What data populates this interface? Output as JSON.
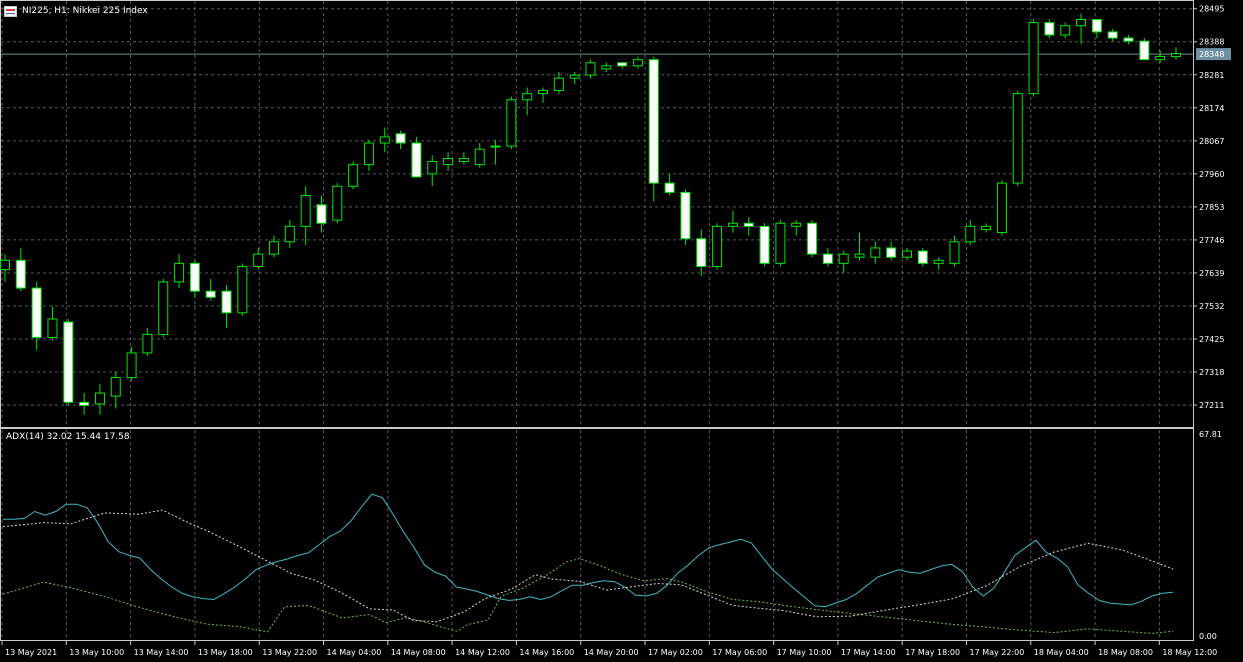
{
  "window": {
    "symbol_title": "NI225, H1:  Nikkei 225 Index",
    "indicator_label": "ADX(14) 32.02 15.44 17.58"
  },
  "colors": {
    "background": "#000000",
    "grid": "#5a5a5a",
    "bull_candle": "#000000",
    "bear_candle": "#ffffff",
    "candle_outline": "#00e600",
    "adx_line": "#3fb8c8",
    "plus_di": "#d8d8d8",
    "minus_di": "#6dbf4b",
    "current_price_line": "#6f8fa3",
    "axis_text": "#ffffff"
  },
  "price_axis": {
    "labels": [
      "28495",
      "28388",
      "28281",
      "28174",
      "28067",
      "27960",
      "27853",
      "27746",
      "27639",
      "27532",
      "27425",
      "27318",
      "27211"
    ],
    "current_price": "28348"
  },
  "indicator_axis": {
    "labels": [
      "67.81",
      "0.00"
    ]
  },
  "time_axis": {
    "labels": [
      "13 May 2021",
      "13 May 10:00",
      "13 May 14:00",
      "13 May 18:00",
      "13 May 22:00",
      "14 May 04:00",
      "14 May 08:00",
      "14 May 12:00",
      "14 May 16:00",
      "14 May 20:00",
      "17 May 02:00",
      "17 May 06:00",
      "17 May 10:00",
      "17 May 14:00",
      "17 May 18:00",
      "17 May 22:00",
      "18 May 04:00",
      "18 May 08:00",
      "18 May 12:00"
    ]
  },
  "chart_data": {
    "type": "candlestick",
    "price_range": [
      27140,
      28520
    ],
    "candles": [
      {
        "o": 27650,
        "h": 27700,
        "l": 27610,
        "c": 27680
      },
      {
        "o": 27680,
        "h": 27720,
        "l": 27580,
        "c": 27590
      },
      {
        "o": 27590,
        "h": 27610,
        "l": 27390,
        "c": 27430
      },
      {
        "o": 27430,
        "h": 27530,
        "l": 27420,
        "c": 27490
      },
      {
        "o": 27480,
        "h": 27490,
        "l": 27210,
        "c": 27220
      },
      {
        "o": 27220,
        "h": 27250,
        "l": 27180,
        "c": 27210
      },
      {
        "o": 27215,
        "h": 27280,
        "l": 27180,
        "c": 27250
      },
      {
        "o": 27240,
        "h": 27320,
        "l": 27200,
        "c": 27300
      },
      {
        "o": 27300,
        "h": 27400,
        "l": 27290,
        "c": 27380
      },
      {
        "o": 27380,
        "h": 27460,
        "l": 27370,
        "c": 27440
      },
      {
        "o": 27440,
        "h": 27620,
        "l": 27430,
        "c": 27610
      },
      {
        "o": 27610,
        "h": 27700,
        "l": 27590,
        "c": 27670
      },
      {
        "o": 27670,
        "h": 27680,
        "l": 27560,
        "c": 27580
      },
      {
        "o": 27580,
        "h": 27620,
        "l": 27550,
        "c": 27560
      },
      {
        "o": 27580,
        "h": 27600,
        "l": 27460,
        "c": 27510
      },
      {
        "o": 27510,
        "h": 27670,
        "l": 27500,
        "c": 27660
      },
      {
        "o": 27660,
        "h": 27720,
        "l": 27650,
        "c": 27700
      },
      {
        "o": 27700,
        "h": 27760,
        "l": 27690,
        "c": 27740
      },
      {
        "o": 27740,
        "h": 27810,
        "l": 27720,
        "c": 27790
      },
      {
        "o": 27790,
        "h": 27920,
        "l": 27730,
        "c": 27890
      },
      {
        "o": 27860,
        "h": 27890,
        "l": 27770,
        "c": 27800
      },
      {
        "o": 27810,
        "h": 27930,
        "l": 27800,
        "c": 27920
      },
      {
        "o": 27920,
        "h": 28000,
        "l": 27910,
        "c": 27990
      },
      {
        "o": 27990,
        "h": 28070,
        "l": 27970,
        "c": 28060
      },
      {
        "o": 28060,
        "h": 28110,
        "l": 28030,
        "c": 28080
      },
      {
        "o": 28090,
        "h": 28100,
        "l": 28040,
        "c": 28060
      },
      {
        "o": 28060,
        "h": 28080,
        "l": 27950,
        "c": 27950
      },
      {
        "o": 27960,
        "h": 28020,
        "l": 27920,
        "c": 28000
      },
      {
        "o": 27990,
        "h": 28030,
        "l": 27970,
        "c": 28010
      },
      {
        "o": 28000,
        "h": 28030,
        "l": 27990,
        "c": 28010
      },
      {
        "o": 27990,
        "h": 28060,
        "l": 27980,
        "c": 28040
      },
      {
        "o": 28050,
        "h": 28070,
        "l": 27990,
        "c": 28050
      },
      {
        "o": 28050,
        "h": 28210,
        "l": 28040,
        "c": 28200
      },
      {
        "o": 28200,
        "h": 28240,
        "l": 28150,
        "c": 28220
      },
      {
        "o": 28220,
        "h": 28240,
        "l": 28190,
        "c": 28230
      },
      {
        "o": 28230,
        "h": 28290,
        "l": 28220,
        "c": 28270
      },
      {
        "o": 28270,
        "h": 28290,
        "l": 28250,
        "c": 28280
      },
      {
        "o": 28280,
        "h": 28330,
        "l": 28270,
        "c": 28320
      },
      {
        "o": 28300,
        "h": 28320,
        "l": 28290,
        "c": 28310
      },
      {
        "o": 28320,
        "h": 28320,
        "l": 28300,
        "c": 28310
      },
      {
        "o": 28310,
        "h": 28340,
        "l": 28300,
        "c": 28330
      },
      {
        "o": 28330,
        "h": 28340,
        "l": 27870,
        "c": 27930
      },
      {
        "o": 27930,
        "h": 27960,
        "l": 27890,
        "c": 27900
      },
      {
        "o": 27900,
        "h": 27910,
        "l": 27730,
        "c": 27750
      },
      {
        "o": 27750,
        "h": 27780,
        "l": 27630,
        "c": 27660
      },
      {
        "o": 27660,
        "h": 27800,
        "l": 27650,
        "c": 27790
      },
      {
        "o": 27790,
        "h": 27840,
        "l": 27770,
        "c": 27800
      },
      {
        "o": 27800,
        "h": 27820,
        "l": 27760,
        "c": 27790
      },
      {
        "o": 27790,
        "h": 27800,
        "l": 27660,
        "c": 27670
      },
      {
        "o": 27670,
        "h": 27810,
        "l": 27660,
        "c": 27800
      },
      {
        "o": 27790,
        "h": 27810,
        "l": 27760,
        "c": 27800
      },
      {
        "o": 27800,
        "h": 27810,
        "l": 27690,
        "c": 27700
      },
      {
        "o": 27700,
        "h": 27720,
        "l": 27660,
        "c": 27670
      },
      {
        "o": 27670,
        "h": 27710,
        "l": 27640,
        "c": 27700
      },
      {
        "o": 27690,
        "h": 27770,
        "l": 27680,
        "c": 27700
      },
      {
        "o": 27690,
        "h": 27740,
        "l": 27670,
        "c": 27720
      },
      {
        "o": 27720,
        "h": 27740,
        "l": 27680,
        "c": 27690
      },
      {
        "o": 27690,
        "h": 27720,
        "l": 27680,
        "c": 27710
      },
      {
        "o": 27710,
        "h": 27720,
        "l": 27660,
        "c": 27670
      },
      {
        "o": 27670,
        "h": 27690,
        "l": 27650,
        "c": 27680
      },
      {
        "o": 27670,
        "h": 27760,
        "l": 27660,
        "c": 27740
      },
      {
        "o": 27740,
        "h": 27810,
        "l": 27730,
        "c": 27790
      },
      {
        "o": 27780,
        "h": 27800,
        "l": 27770,
        "c": 27790
      },
      {
        "o": 27770,
        "h": 27940,
        "l": 27760,
        "c": 27930
      },
      {
        "o": 27930,
        "h": 28230,
        "l": 27920,
        "c": 28220
      },
      {
        "o": 28220,
        "h": 28460,
        "l": 28210,
        "c": 28450
      },
      {
        "o": 28450,
        "h": 28460,
        "l": 28400,
        "c": 28410
      },
      {
        "o": 28410,
        "h": 28450,
        "l": 28400,
        "c": 28440
      },
      {
        "o": 28440,
        "h": 28480,
        "l": 28380,
        "c": 28460
      },
      {
        "o": 28460,
        "h": 28460,
        "l": 28400,
        "c": 28420
      },
      {
        "o": 28420,
        "h": 28430,
        "l": 28390,
        "c": 28400
      },
      {
        "o": 28400,
        "h": 28410,
        "l": 28380,
        "c": 28390
      },
      {
        "o": 28390,
        "h": 28400,
        "l": 28330,
        "c": 28330
      },
      {
        "o": 28330,
        "h": 28360,
        "l": 28320,
        "c": 28340
      },
      {
        "o": 28340,
        "h": 28370,
        "l": 28330,
        "c": 28350
      }
    ],
    "adx_range": [
      0,
      67.81
    ],
    "adx": [
      38.99,
      38.99,
      39.22,
      41.49,
      40.33,
      41.49,
      43.81,
      43.81,
      42.65,
      37.71,
      31.66,
      28.47,
      27.31,
      26.45,
      22.72,
      19.72,
      17.1,
      15.06,
      13.96,
      13.38,
      13.09,
      15.06,
      17.1,
      19.72,
      22.72,
      24.17,
      25.33,
      26.2,
      27.31,
      28.18,
      30.79,
      33.4,
      35.15,
      38.41,
      42.9,
      47.09,
      45.95,
      40.62,
      34.91,
      29.79,
      24.17,
      21.85,
      20.63,
      17.1,
      16.47,
      15.65,
      14.51,
      13.38,
      12.8,
      13.09,
      13.96,
      13.09,
      13.96,
      15.93,
      17.68,
      17.68,
      18.55,
      19.13,
      18.84,
      17.1,
      14.51,
      14.22,
      15.06,
      17.68,
      21.56,
      24.17,
      27.31,
      29.79,
      30.79,
      31.66,
      32.53,
      31.37,
      27.0,
      22.72,
      19.72,
      16.76,
      13.96,
      11.06,
      10.76,
      11.93,
      13.09,
      15.06,
      17.68,
      20.34,
      21.56,
      22.72,
      21.85,
      21.56,
      22.72,
      23.88,
      24.45,
      22.14,
      17.1,
      14.22,
      16.76,
      21.85,
      27.31,
      29.8,
      32.24,
      28.18,
      26.45,
      23.59,
      17.68,
      15.06,
      12.8,
      11.93,
      11.64,
      11.35,
      12.51,
      14.22,
      15.07,
      15.44
    ],
    "plus_di": [
      [
        0,
        14.81
      ],
      [
        12,
        18.7
      ],
      [
        20,
        16.84
      ],
      [
        30,
        14.05
      ],
      [
        40,
        10.58
      ],
      [
        50,
        7.61
      ],
      [
        60,
        5.15
      ],
      [
        70,
        4.27
      ],
      [
        78,
        2.63
      ],
      [
        83,
        10.69
      ],
      [
        90,
        11.2
      ],
      [
        100,
        7.15
      ],
      [
        108,
        8.21
      ],
      [
        113,
        5.63
      ],
      [
        119,
        7.24
      ],
      [
        124,
        5.92
      ],
      [
        129,
        4.22
      ],
      [
        134,
        2.85
      ],
      [
        137,
        4.98
      ],
      [
        143,
        6.47
      ],
      [
        147,
        14.21
      ],
      [
        153,
        16.62
      ],
      [
        160,
        20.74
      ],
      [
        166,
        25.15
      ],
      [
        170,
        26.29
      ],
      [
        176,
        24.01
      ],
      [
        182,
        21.29
      ],
      [
        189,
        19.13
      ],
      [
        196,
        19.84
      ],
      [
        200,
        18.77
      ],
      [
        208,
        15.44
      ],
      [
        215,
        13.12
      ],
      [
        223,
        12.36
      ],
      [
        230,
        11.19
      ],
      [
        240,
        9.81
      ],
      [
        250,
        8.54
      ],
      [
        260,
        7.43
      ],
      [
        270,
        6.21
      ],
      [
        280,
        5.04
      ],
      [
        290,
        4.16
      ],
      [
        300,
        3.18
      ],
      [
        310,
        2.4
      ],
      [
        320,
        3.62
      ],
      [
        330,
        2.81
      ],
      [
        339,
        2.14
      ],
      [
        345,
        2.85
      ]
    ],
    "minus_di": [
      [
        0,
        36.58
      ],
      [
        12,
        37.91
      ],
      [
        20,
        37.52
      ],
      [
        30,
        41.05
      ],
      [
        40,
        40.63
      ],
      [
        47,
        41.94
      ],
      [
        55,
        37.69
      ],
      [
        60,
        35.37
      ],
      [
        70,
        29.95
      ],
      [
        78,
        25.45
      ],
      [
        85,
        21.47
      ],
      [
        92,
        19.31
      ],
      [
        100,
        15.15
      ],
      [
        108,
        10.07
      ],
      [
        115,
        9.67
      ],
      [
        121,
        6.31
      ],
      [
        128,
        5.92
      ],
      [
        136,
        9.12
      ],
      [
        142,
        13.27
      ],
      [
        150,
        16.49
      ],
      [
        157,
        21.1
      ],
      [
        162,
        19.65
      ],
      [
        170,
        18.91
      ],
      [
        178,
        16.13
      ],
      [
        186,
        17.27
      ],
      [
        193,
        18.23
      ],
      [
        200,
        17.81
      ],
      [
        208,
        14.29
      ],
      [
        215,
        11.24
      ],
      [
        223,
        10.24
      ],
      [
        230,
        9.51
      ],
      [
        240,
        7.5
      ],
      [
        250,
        7.72
      ],
      [
        260,
        9.62
      ],
      [
        270,
        11.38
      ],
      [
        280,
        13.3
      ],
      [
        290,
        17.49
      ],
      [
        300,
        23.8
      ],
      [
        310,
        28.43
      ],
      [
        320,
        31.21
      ],
      [
        330,
        29.09
      ],
      [
        339,
        25.43
      ],
      [
        345,
        22.93
      ]
    ]
  }
}
